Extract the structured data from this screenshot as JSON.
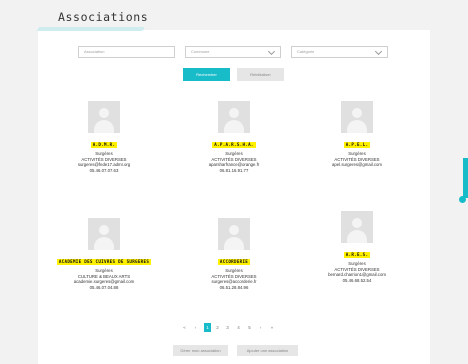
{
  "page": {
    "title": "Associations"
  },
  "filters": {
    "association_placeholder": "Association",
    "commune_placeholder": "Commune",
    "categorie_placeholder": "Catégorie",
    "search_label": "Rechercher",
    "reset_label": "Réinitialiser"
  },
  "cards": [
    {
      "name": "A.D.M.R.",
      "city": "Surgères",
      "category": "ACTIVITÉS DIVERSES",
      "email": "surgeres@fede17.admr.org",
      "phone": "05.46.07.07.63"
    },
    {
      "name": "A.P.A.R.S.H.A.",
      "city": "Surgères",
      "category": "ACTIVITÉS DIVERSES",
      "email": "aparsharfrance@orange.fr",
      "phone": "06.81.16.91.77"
    },
    {
      "name": "A.P.E.L.",
      "city": "Surgères",
      "category": "ACTIVITÉS DIVERSES",
      "email": "apel.surgeres@gmail.com",
      "phone": ""
    },
    {
      "name": "ACADEMIE DES CUIVRES DE SURGERES",
      "city": "Surgères",
      "category": "CULTURE & BEAUX ARTS",
      "email": "academie.surgeres@gmail.com",
      "phone": "05.46.07.04.88"
    },
    {
      "name": "ACCORDERIE",
      "city": "Surgères",
      "category": "ACTIVITÉS DIVERSES",
      "email": "surgeres@accorderie.fr",
      "phone": "06.51.28.84.96"
    },
    {
      "name": "A.R.E.S.",
      "city": "Surgères",
      "category": "ACTIVITÉS DIVERSES",
      "email": "bernard.charrion1@gmail.com",
      "phone": "05.46.68.52.54"
    }
  ],
  "pagination": {
    "first": "«",
    "prev": "‹",
    "pages": [
      "1",
      "2",
      "3",
      "4",
      "5"
    ],
    "next": "›",
    "last": "»",
    "current": "1"
  },
  "actions": {
    "manage": "Gérer mon association",
    "add": "Ajouter une association"
  }
}
